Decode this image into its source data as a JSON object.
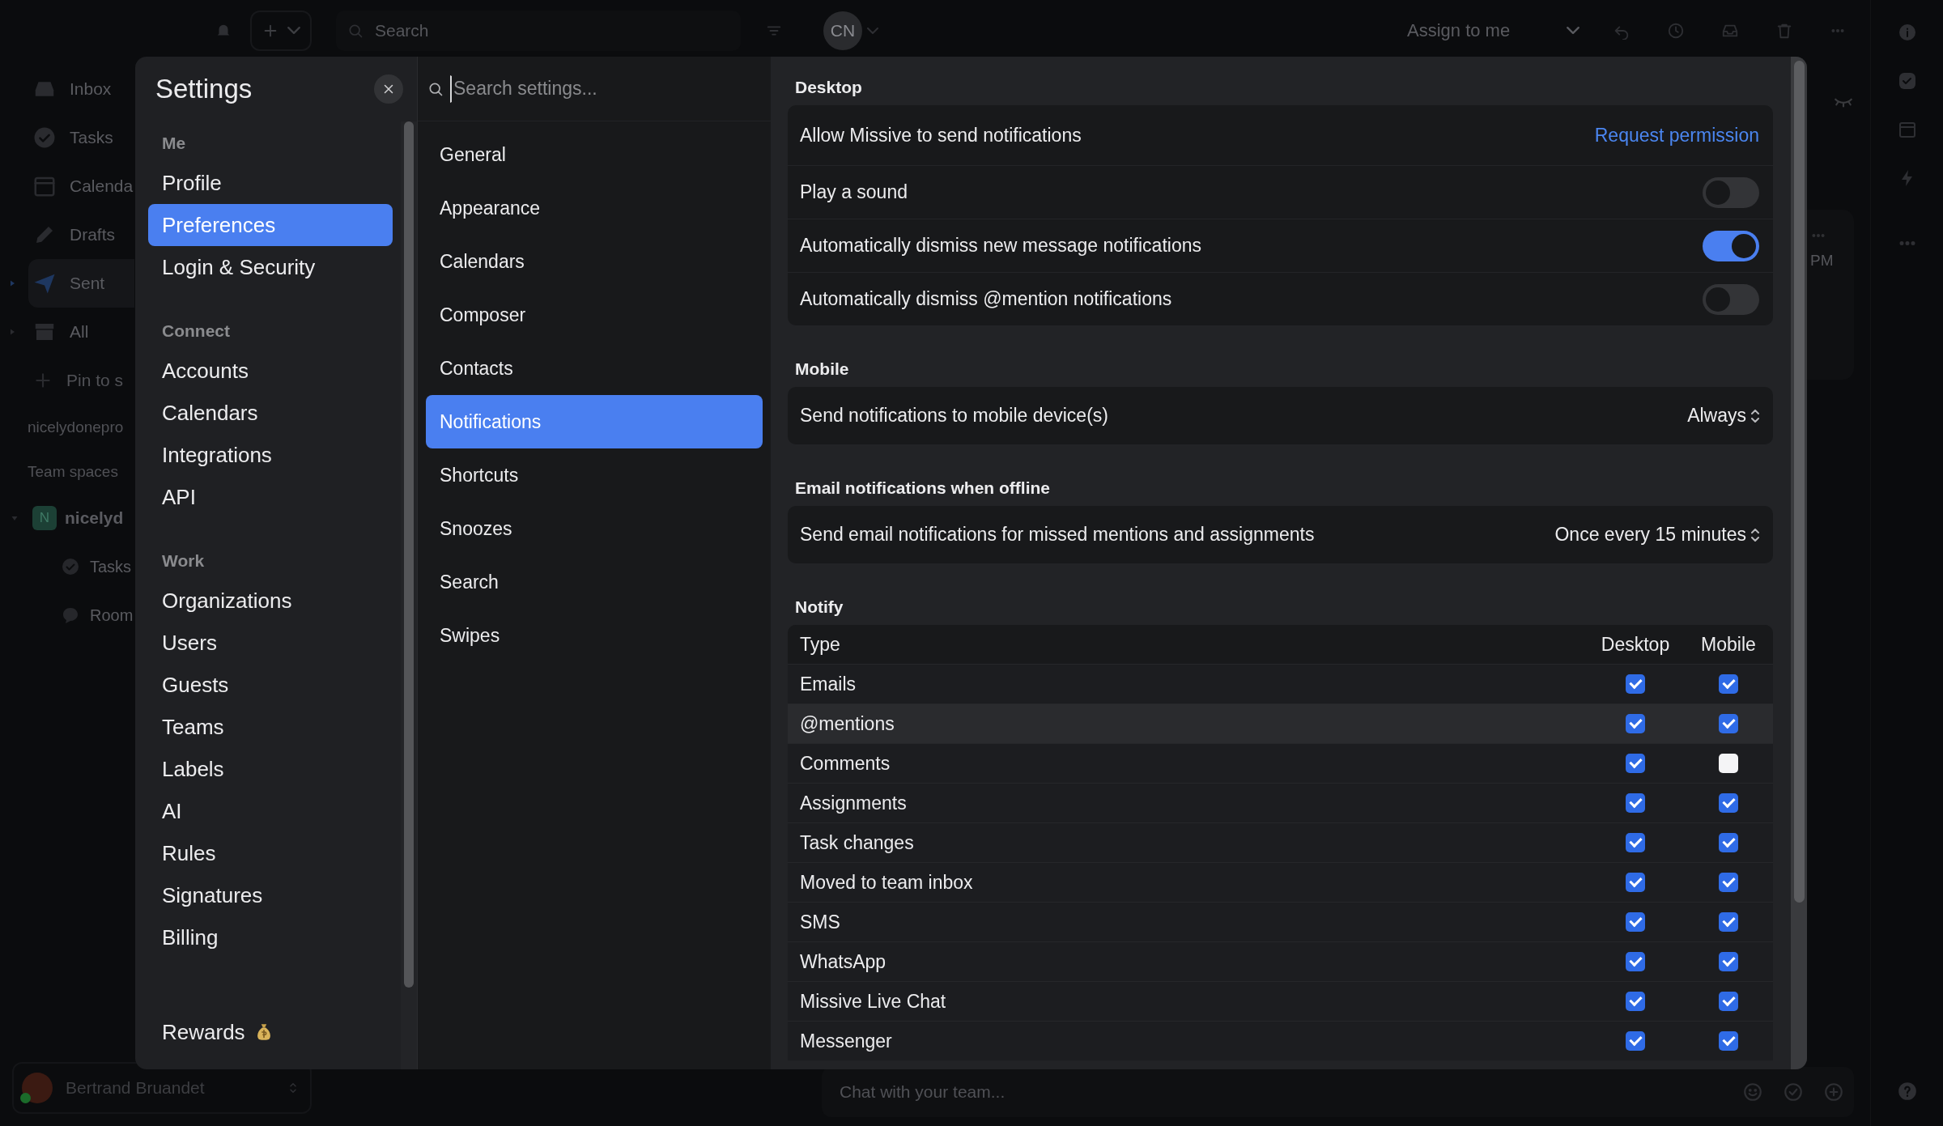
{
  "top_bar": {
    "search": {
      "placeholder": "Search"
    },
    "avatar": {
      "initials": "CN"
    },
    "assign": {
      "value": "Assign to me"
    }
  },
  "sidebar": {
    "items": [
      {
        "label": "Inbox",
        "kind": "inbox",
        "expandable": false,
        "selected": false
      },
      {
        "label": "Tasks",
        "kind": "check",
        "expandable": false,
        "selected": false
      },
      {
        "label": "Calenda",
        "kind": "calendar",
        "expandable": false,
        "selected": false
      },
      {
        "label": "Drafts",
        "kind": "pencil",
        "expandable": false,
        "selected": false
      },
      {
        "label": "Sent",
        "kind": "send",
        "expandable": true,
        "selected": true
      },
      {
        "label": "All",
        "kind": "archive",
        "expandable": true,
        "selected": false
      }
    ],
    "pin": {
      "label": "Pin to s"
    },
    "org": "nicelydonepro",
    "team_spaces_heading": "Team spaces",
    "team": {
      "badge": "N",
      "name": "nicelyd",
      "expanded": true,
      "children": [
        {
          "label": "Tasks",
          "kind": "check"
        },
        {
          "label": "Room",
          "kind": "chat"
        }
      ]
    }
  },
  "user": {
    "name": "Bertrand Bruandet",
    "online": true
  },
  "conversation_peek": {
    "time": "PM"
  },
  "composer": {
    "placeholder": "Chat with your team..."
  },
  "settings": {
    "title": "Settings",
    "nav": [
      {
        "heading": "Me",
        "items": [
          {
            "label": "Profile",
            "selected": false
          },
          {
            "label": "Preferences",
            "selected": true
          },
          {
            "label": "Login & Security",
            "selected": false
          }
        ]
      },
      {
        "heading": "Connect",
        "items": [
          {
            "label": "Accounts",
            "selected": false
          },
          {
            "label": "Calendars",
            "selected": false
          },
          {
            "label": "Integrations",
            "selected": false
          },
          {
            "label": "API",
            "selected": false
          }
        ]
      },
      {
        "heading": "Work",
        "items": [
          {
            "label": "Organizations",
            "selected": false
          },
          {
            "label": "Users",
            "selected": false
          },
          {
            "label": "Guests",
            "selected": false
          },
          {
            "label": "Teams",
            "selected": false
          },
          {
            "label": "Labels",
            "selected": false
          },
          {
            "label": "AI",
            "selected": false
          },
          {
            "label": "Rules",
            "selected": false
          },
          {
            "label": "Signatures",
            "selected": false
          },
          {
            "label": "Billing",
            "selected": false
          }
        ]
      }
    ],
    "rewards": {
      "label": "Rewards",
      "selected": false
    },
    "search": {
      "placeholder": "Search settings..."
    },
    "sections": [
      {
        "label": "General",
        "selected": false
      },
      {
        "label": "Appearance",
        "selected": false
      },
      {
        "label": "Calendars",
        "selected": false
      },
      {
        "label": "Composer",
        "selected": false
      },
      {
        "label": "Contacts",
        "selected": false
      },
      {
        "label": "Notifications",
        "selected": true
      },
      {
        "label": "Shortcuts",
        "selected": false
      },
      {
        "label": "Snoozes",
        "selected": false
      },
      {
        "label": "Search",
        "selected": false
      },
      {
        "label": "Swipes",
        "selected": false
      }
    ],
    "groups": [
      {
        "heading": "Desktop",
        "rows": [
          {
            "kind": "link",
            "label": "Allow Missive to send notifications",
            "action": "Request permission"
          },
          {
            "kind": "toggle",
            "label": "Play a sound",
            "on": false
          },
          {
            "kind": "toggle",
            "label": "Automatically dismiss new message notifications",
            "on": true
          },
          {
            "kind": "toggle",
            "label": "Automatically dismiss @mention notifications",
            "on": false
          }
        ]
      },
      {
        "heading": "Mobile",
        "rows": [
          {
            "kind": "select",
            "label": "Send notifications to mobile device(s)",
            "value": "Always"
          }
        ]
      },
      {
        "heading": "Email notifications when offline",
        "rows": [
          {
            "kind": "select",
            "label": "Send email notifications for missed mentions and assignments",
            "value": "Once every 15 minutes"
          }
        ]
      }
    ],
    "notify": {
      "heading": "Notify",
      "columns": [
        "Type",
        "Desktop",
        "Mobile"
      ],
      "rows": [
        {
          "type": "Emails",
          "desktop": true,
          "mobile": true,
          "highlighted": false
        },
        {
          "type": "@mentions",
          "desktop": true,
          "mobile": true,
          "highlighted": true
        },
        {
          "type": "Comments",
          "desktop": true,
          "mobile": false,
          "highlighted": false
        },
        {
          "type": "Assignments",
          "desktop": true,
          "mobile": true,
          "highlighted": false
        },
        {
          "type": "Task changes",
          "desktop": true,
          "mobile": true,
          "highlighted": false
        },
        {
          "type": "Moved to team inbox",
          "desktop": true,
          "mobile": true,
          "highlighted": false
        },
        {
          "type": "SMS",
          "desktop": true,
          "mobile": true,
          "highlighted": false
        },
        {
          "type": "WhatsApp",
          "desktop": true,
          "mobile": true,
          "highlighted": false
        },
        {
          "type": "Missive Live Chat",
          "desktop": true,
          "mobile": true,
          "highlighted": false
        },
        {
          "type": "Messenger",
          "desktop": true,
          "mobile": true,
          "highlighted": false
        }
      ]
    }
  }
}
